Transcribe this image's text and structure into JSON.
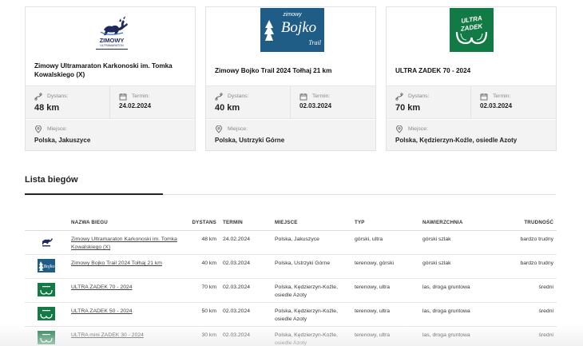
{
  "cards": [
    {
      "logo": "zimowy-ultramaraton-logo",
      "logo_text": "ZIMOWY",
      "logo_subtext": "ULTRAMARATON",
      "title": "Zimowy Ultramaraton Karkonoski im. Tomka Kowalskiego (X)",
      "dist_label": "Dystans:",
      "dist_value": "48 km",
      "term_label": "Termin:",
      "term_value": "24.02.2024",
      "place_label": "Miejsce:",
      "place_value": "Polska, Jakuszyce"
    },
    {
      "logo": "zimowy-bojko-trail-logo",
      "logo_text_top": "zimowy",
      "logo_text_main": "Bojko",
      "logo_text_bottom": "Trail",
      "title": "Zimowy Bojko Trail 2024 Tołhaj 21 km",
      "dist_label": "Dystans:",
      "dist_value": "40 km",
      "term_label": "Termin:",
      "term_value": "02.03.2024",
      "place_label": "Miejsce:",
      "place_value": "Polska, Ustrzyki Górne"
    },
    {
      "logo": "ultra-zadek-logo",
      "logo_text_top": "ULTRA",
      "logo_text_bottom": "ZADEK",
      "title": "ULTRA ZADEK 70 - 2024",
      "dist_label": "Dystans:",
      "dist_value": "70 km",
      "term_label": "Termin:",
      "term_value": "02.03.2024",
      "place_label": "Miejsce:",
      "place_value": "Polska, Kędzierzyn-Koźle, osiedle Azoty"
    }
  ],
  "section_title": "Lista biegów",
  "table": {
    "headers": {
      "name": "NAZWA BIEGU",
      "dist": "DYSTANS",
      "term": "TERMIN",
      "place": "MIEJSCE",
      "type": "TYP",
      "surface": "NAWIERZCHNIA",
      "difficulty": "TRUDNOŚĆ"
    },
    "rows": [
      {
        "thumb": "zimowy-ultramaraton-logo",
        "name": "Zimowy Ultramaraton Karkonoski im. Tomka Kowalskiego (X)",
        "dist": "48 km",
        "term": "24.02.2024",
        "place": "Polska, Jakuszyce",
        "type": "górski, ultra",
        "surface": "górski szlak",
        "difficulty": "bardzo trudny"
      },
      {
        "thumb": "zimowy-bojko-trail-logo",
        "name": "Zimowy Bojko Trail 2024 Tołhaj 21 km",
        "dist": "40 km",
        "term": "02.03.2024",
        "place": "Polska, Ustrzyki Górne",
        "type": "terenowy, górski",
        "surface": "górski szlak",
        "difficulty": "bardzo trudny"
      },
      {
        "thumb": "ultra-zadek-logo",
        "name": "ULTRA ZADEK 70 - 2024",
        "dist": "70 km",
        "term": "02.03.2024",
        "place": "Polska, Kędzierzyn-Koźle, osiedle Azoty",
        "type": "terenowy, ultra",
        "surface": "las, droga gruntowa",
        "difficulty": "średni"
      },
      {
        "thumb": "ultra-zadek-logo",
        "name": "ULTRA ZADEK 50 - 2024",
        "dist": "50 km",
        "term": "02.03.2024",
        "place": "Polska, Kędzierzyn-Koźle, osiedle Azoty",
        "type": "terenowy, ultra",
        "surface": "las, droga gruntowa",
        "difficulty": "średni"
      },
      {
        "thumb": "ultra-zadek-logo",
        "name": "ULTRA mini ZADEK 30 - 2024",
        "dist": "30 km",
        "term": "02.03.2024",
        "place": "Polska, Kędzierzyn-Koźle, osiedle Azoty",
        "type": "terenowy, ultra",
        "surface": "las, droga gruntowa",
        "difficulty": "średni"
      }
    ]
  },
  "colors": {
    "bojko_blue": "#1f5d87",
    "zadek_green": "#127a44",
    "card_row_bg": "#f3f3f3",
    "tab_active": "#222222"
  }
}
